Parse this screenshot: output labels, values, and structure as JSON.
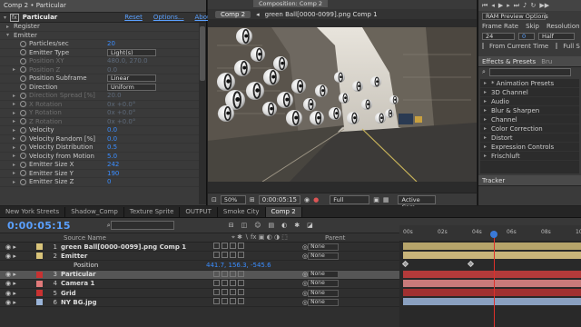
{
  "effect_controls": {
    "panel_title": "Comp 2 • Particular",
    "effect_name": "Particular",
    "reset": "Reset",
    "options": "Options...",
    "about": "About...",
    "params": [
      {
        "name": "Register",
        "value": "",
        "indent": 1,
        "dim": false,
        "tri": "▸"
      },
      {
        "name": "Emitter",
        "value": "",
        "indent": 1,
        "dim": false,
        "tri": "▾"
      },
      {
        "name": "Particles/sec",
        "value": "20",
        "indent": 2,
        "dim": false,
        "tri": ""
      },
      {
        "name": "Emitter Type",
        "value": "Light(s)",
        "indent": 2,
        "dim": false,
        "tri": "",
        "dropdown": true
      },
      {
        "name": "Position XY",
        "value": "480.0, 270.0",
        "indent": 2,
        "dim": true,
        "tri": ""
      },
      {
        "name": "Position Z",
        "value": "0.0",
        "indent": 2,
        "dim": true,
        "tri": "▸"
      },
      {
        "name": "Position Subframe",
        "value": "Linear",
        "indent": 2,
        "dim": false,
        "tri": "",
        "dropdown": true
      },
      {
        "name": "Direction",
        "value": "Uniform",
        "indent": 2,
        "dim": false,
        "tri": "",
        "dropdown": true
      },
      {
        "name": "Direction Spread [%]",
        "value": "20.0",
        "indent": 2,
        "dim": true,
        "tri": "▸"
      },
      {
        "name": "X Rotation",
        "value": "0x +0.0°",
        "indent": 2,
        "dim": true,
        "tri": "▸"
      },
      {
        "name": "Y Rotation",
        "value": "0x +0.0°",
        "indent": 2,
        "dim": true,
        "tri": "▸"
      },
      {
        "name": "Z Rotation",
        "value": "0x +0.0°",
        "indent": 2,
        "dim": true,
        "tri": "▸"
      },
      {
        "name": "Velocity",
        "value": "0.0",
        "indent": 2,
        "dim": false,
        "tri": "▸"
      },
      {
        "name": "Velocity Random [%]",
        "value": "0.0",
        "indent": 2,
        "dim": false,
        "tri": "▸"
      },
      {
        "name": "Velocity Distribution",
        "value": "0.5",
        "indent": 2,
        "dim": false,
        "tri": "▸"
      },
      {
        "name": "Velocity from Motion",
        "value": "5.0",
        "indent": 2,
        "dim": false,
        "tri": "▸"
      },
      {
        "name": "Emitter Size X",
        "value": "242",
        "indent": 2,
        "dim": false,
        "tri": "▸"
      },
      {
        "name": "Emitter Size Y",
        "value": "190",
        "indent": 2,
        "dim": false,
        "tri": "▸"
      },
      {
        "name": "Emitter Size Z",
        "value": "0",
        "indent": 2,
        "dim": false,
        "tri": "▸"
      }
    ]
  },
  "composition": {
    "tab": "Composition: Comp 2",
    "active_tab": "Comp 2",
    "breadcrumb_layer": "green Ball[0000-0099].png Comp 1",
    "zoom": "50%",
    "current_time": "0:00:05:15",
    "resolution": "Full",
    "camera": "Active Cam"
  },
  "preview": {
    "ram_preview": "RAM Preview Options",
    "frame_rate_label": "Frame Rate",
    "skip_label": "Skip",
    "resolution_label": "Resolution",
    "frame_rate": "24",
    "skip": "0",
    "resolution": "Half",
    "from_current": "From Current Time",
    "full_screen": "Full S"
  },
  "effects_presets": {
    "title": "Effects & Presets",
    "tab2": "Bru",
    "search_placeholder": "",
    "items": [
      "* Animation Presets",
      "3D Channel",
      "Audio",
      "Blur & Sharpen",
      "Channel",
      "Color Correction",
      "Distort",
      "Expression Controls",
      "Frischluft"
    ],
    "tracker": "Tracker"
  },
  "timeline": {
    "tabs": [
      "New York Streets",
      "Shadow_Comp",
      "Texture Sprite",
      "OUTPUT",
      "Smoke City",
      "Comp 2"
    ],
    "active_tab": "Comp 2",
    "time": "0:00:05:15",
    "search_placeholder": "",
    "col_source": "Source Name",
    "col_parent": "Parent",
    "layers": [
      {
        "num": "1",
        "name": "green Ball[0000-0099].png Comp 1",
        "color": "#d9c47a",
        "parent": "None",
        "bold": true,
        "selected": false
      },
      {
        "num": "2",
        "name": "Emitter",
        "color": "#d9c47a",
        "parent": "None",
        "bold": true,
        "selected": false
      },
      {
        "num": "",
        "name": "Position",
        "color": "",
        "parent": "",
        "bold": false,
        "selected": false,
        "value": "441.7, 156.3, -545.6"
      },
      {
        "num": "3",
        "name": "Particular",
        "color": "#c83232",
        "parent": "None",
        "bold": true,
        "selected": true
      },
      {
        "num": "4",
        "name": "Camera 1",
        "color": "#e07a7a",
        "parent": "None",
        "bold": true,
        "selected": false
      },
      {
        "num": "5",
        "name": "Grid",
        "color": "#c83232",
        "parent": "None",
        "bold": true,
        "selected": false
      },
      {
        "num": "6",
        "name": "NY BG.jpg",
        "color": "#9ab4d8",
        "parent": "None",
        "bold": true,
        "selected": false
      }
    ],
    "ruler": [
      "00s",
      "02s",
      "04s",
      "06s",
      "08s",
      "10s"
    ],
    "playhead_frac": 0.52
  }
}
